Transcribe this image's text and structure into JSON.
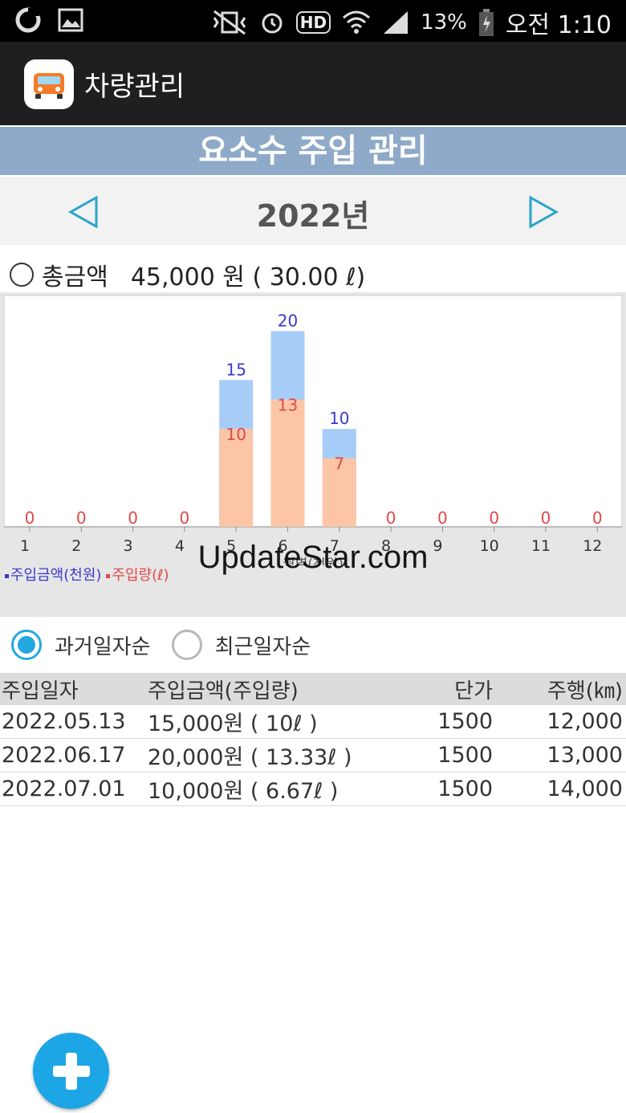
{
  "status_bar": {
    "battery_pct": "13%",
    "time": "오전 1:10",
    "hd_label": "HD"
  },
  "app": {
    "title": "차량관리",
    "icon": "car-icon"
  },
  "page": {
    "header": "요소수 주입 관리",
    "year": "2022년"
  },
  "summary": {
    "label": "총금액",
    "value": "45,000 원 ( 30.00 ℓ)"
  },
  "chart_data": {
    "type": "bar",
    "categories": [
      "1",
      "2",
      "3",
      "4",
      "5",
      "6",
      "7",
      "8",
      "9",
      "10",
      "11",
      "12"
    ],
    "series": [
      {
        "name": "주입금액(천원)",
        "values": [
          0,
          0,
          0,
          0,
          15,
          20,
          10,
          0,
          0,
          0,
          0,
          0
        ],
        "color": "#a6cdf7",
        "label_color": "#3a3acc"
      },
      {
        "name": "주입량(ℓ)",
        "values": [
          0,
          0,
          0,
          0,
          10,
          13,
          7,
          0,
          0,
          0,
          0,
          0
        ],
        "color": "#fcc6a6",
        "label_color": "#e04848"
      }
    ],
    "data_labels_series1": [
      "",
      "",
      "",
      "",
      "15",
      "20",
      "10",
      "",
      "",
      "",
      "",
      ""
    ],
    "data_labels_series2": [
      "0",
      "0",
      "0",
      "0",
      "10",
      "13",
      "7",
      "0",
      "0",
      "0",
      "0",
      "0"
    ],
    "xlabel": "월별(천원)",
    "ylim": [
      0,
      22
    ],
    "legend_position": "bottom-left",
    "grid": false
  },
  "watermark": "UpdateStar.com",
  "sort": {
    "option1": "과거일자순",
    "option2": "최근일자순",
    "selected": "option1"
  },
  "table": {
    "headers": {
      "date": "주입일자",
      "amount": "주입금액(주입량)",
      "unit_price": "단가",
      "mileage": "주행(㎞)"
    },
    "rows": [
      {
        "date": "2022.05.13",
        "amount": "15,000원 ( 10ℓ )",
        "unit_price": "1500",
        "mileage": "12,000"
      },
      {
        "date": "2022.06.17",
        "amount": "20,000원 ( 13.33ℓ )",
        "unit_price": "1500",
        "mileage": "13,000"
      },
      {
        "date": "2022.07.01",
        "amount": "10,000원 ( 6.67ℓ )",
        "unit_price": "1500",
        "mileage": "14,000"
      }
    ]
  },
  "colors": {
    "header_bg": "#8eaac8",
    "accent": "#23a8e0",
    "fab": "#1da6e6"
  }
}
